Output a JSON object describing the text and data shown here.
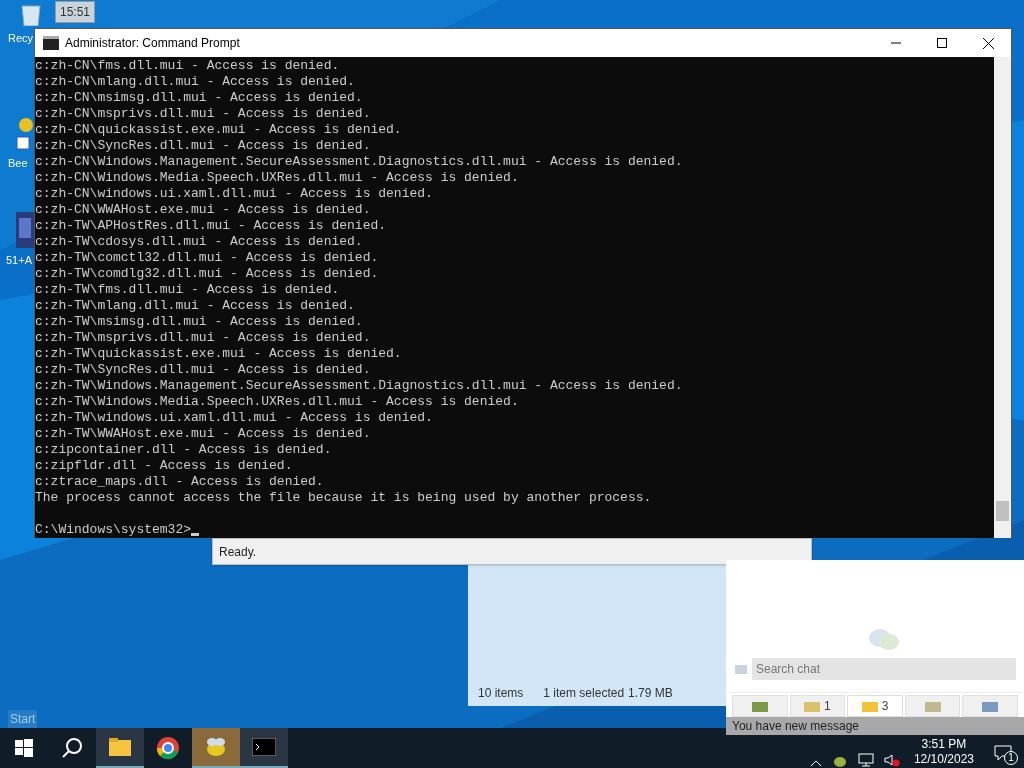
{
  "desktop_icons": [
    {
      "label": "Recy"
    },
    {
      "label": "Bee"
    },
    {
      "label": "51+A"
    }
  ],
  "tooltip": "15:51",
  "start_label": "Start",
  "console": {
    "title": "Administrator: Command Prompt",
    "lines": [
      "c:zh-CN\\fms.dll.mui - Access is denied.",
      "c:zh-CN\\mlang.dll.mui - Access is denied.",
      "c:zh-CN\\msimsg.dll.mui - Access is denied.",
      "c:zh-CN\\msprivs.dll.mui - Access is denied.",
      "c:zh-CN\\quickassist.exe.mui - Access is denied.",
      "c:zh-CN\\SyncRes.dll.mui - Access is denied.",
      "c:zh-CN\\Windows.Management.SecureAssessment.Diagnostics.dll.mui - Access is denied.",
      "c:zh-CN\\Windows.Media.Speech.UXRes.dll.mui - Access is denied.",
      "c:zh-CN\\windows.ui.xaml.dll.mui - Access is denied.",
      "c:zh-CN\\WWAHost.exe.mui - Access is denied.",
      "c:zh-TW\\APHostRes.dll.mui - Access is denied.",
      "c:zh-TW\\cdosys.dll.mui - Access is denied.",
      "c:zh-TW\\comctl32.dll.mui - Access is denied.",
      "c:zh-TW\\comdlg32.dll.mui - Access is denied.",
      "c:zh-TW\\fms.dll.mui - Access is denied.",
      "c:zh-TW\\mlang.dll.mui - Access is denied.",
      "c:zh-TW\\msimsg.dll.mui - Access is denied.",
      "c:zh-TW\\msprivs.dll.mui - Access is denied.",
      "c:zh-TW\\quickassist.exe.mui - Access is denied.",
      "c:zh-TW\\SyncRes.dll.mui - Access is denied.",
      "c:zh-TW\\Windows.Management.SecureAssessment.Diagnostics.dll.mui - Access is denied.",
      "c:zh-TW\\Windows.Media.Speech.UXRes.dll.mui - Access is denied.",
      "c:zh-TW\\windows.ui.xaml.dll.mui - Access is denied.",
      "c:zh-TW\\WWAHost.exe.mui - Access is denied.",
      "c:zipcontainer.dll - Access is denied.",
      "c:zipfldr.dll - Access is denied.",
      "c:ztrace_maps.dll - Access is denied.",
      "The process cannot access the file because it is being used by another process."
    ],
    "prompt": "C:\\Windows\\system32>"
  },
  "status_dialog": {
    "status": "Ready."
  },
  "explorer": {
    "item_count": "10 items",
    "selection": "1 item selected",
    "size": "1.79 MB"
  },
  "chat": {
    "search": {
      "placeholder": "Search chat"
    },
    "tabs": [
      {
        "selected": false
      },
      {
        "count": "1",
        "selected": false
      },
      {
        "count": "3",
        "selected": true
      },
      {
        "selected": false
      },
      {
        "selected": false
      }
    ],
    "notice": "You have new message"
  },
  "taskbar": {
    "apps": [
      {
        "kind": "start",
        "active": false
      },
      {
        "kind": "search",
        "active": false
      },
      {
        "kind": "folder",
        "active": true
      },
      {
        "kind": "browser",
        "active": false
      },
      {
        "kind": "bee",
        "active": true
      },
      {
        "kind": "console",
        "active": true
      }
    ],
    "time": "3:51 PM",
    "date": "12/10/2023",
    "notifications": "1"
  }
}
